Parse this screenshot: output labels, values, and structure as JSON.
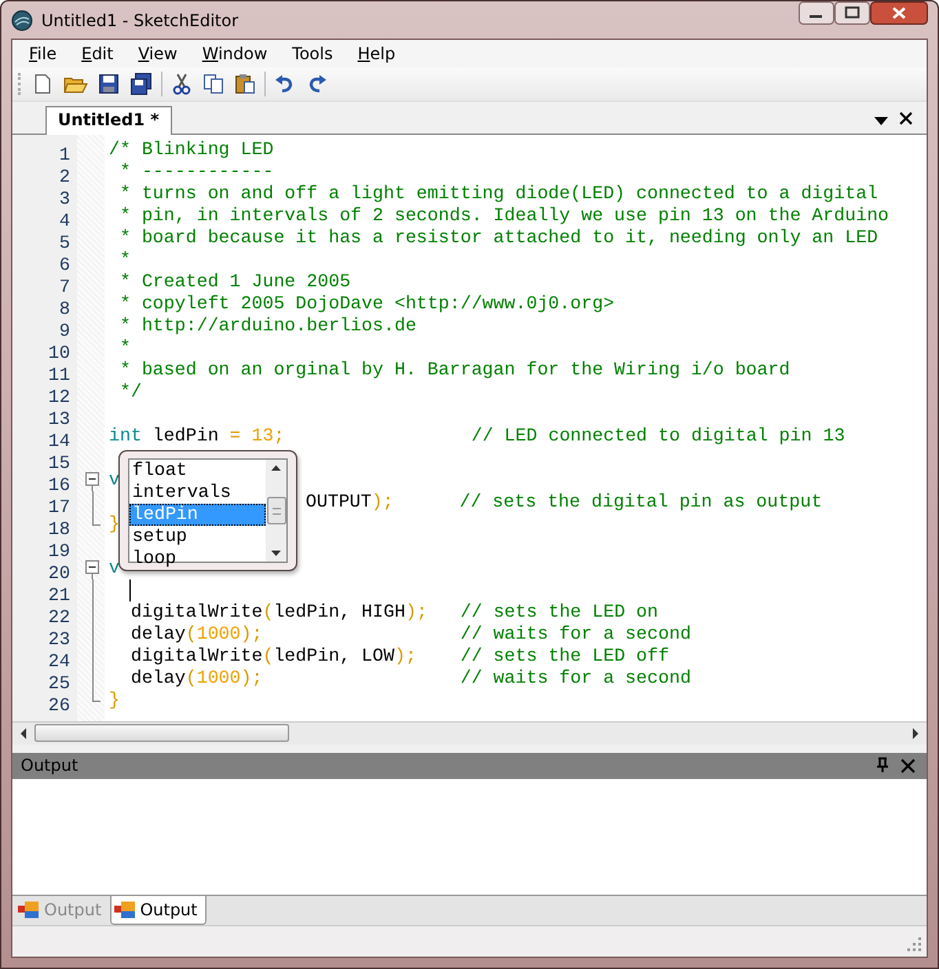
{
  "window": {
    "title": "Untitled1 - SketchEditor"
  },
  "menu": [
    {
      "label": "File",
      "underline": true
    },
    {
      "label": "Edit",
      "underline": true
    },
    {
      "label": "View",
      "underline": true
    },
    {
      "label": "Window",
      "underline": true
    },
    {
      "label": "Tools",
      "underline": false
    },
    {
      "label": "Help",
      "underline": true
    }
  ],
  "document_tabs": [
    {
      "label": "Untitled1 *",
      "selected": true
    }
  ],
  "editor": {
    "lines": [
      {
        "number": "1",
        "tokens": [
          {
            "kind": "comment",
            "text": "/* Blinking LED"
          }
        ]
      },
      {
        "number": "2",
        "tokens": [
          {
            "kind": "comment",
            "text": " * ------------"
          }
        ]
      },
      {
        "number": "3",
        "tokens": [
          {
            "kind": "comment",
            "text": " * turns on and off a light emitting diode(LED) connected to a digital"
          }
        ]
      },
      {
        "number": "4",
        "tokens": [
          {
            "kind": "comment",
            "text": " * pin, in intervals of 2 seconds. Ideally we use pin 13 on the Arduino"
          }
        ]
      },
      {
        "number": "5",
        "tokens": [
          {
            "kind": "comment",
            "text": " * board because it has a resistor attached to it, needing only an LED"
          }
        ]
      },
      {
        "number": "6",
        "tokens": [
          {
            "kind": "comment",
            "text": " *"
          }
        ]
      },
      {
        "number": "7",
        "tokens": [
          {
            "kind": "comment",
            "text": " * Created 1 June 2005"
          }
        ]
      },
      {
        "number": "8",
        "tokens": [
          {
            "kind": "comment",
            "text": " * copyleft 2005 DojoDave <http://www.0j0.org>"
          }
        ]
      },
      {
        "number": "9",
        "tokens": [
          {
            "kind": "comment",
            "text": " * http://arduino.berlios.de"
          }
        ]
      },
      {
        "number": "10",
        "tokens": [
          {
            "kind": "comment",
            "text": " *"
          }
        ]
      },
      {
        "number": "11",
        "tokens": [
          {
            "kind": "comment",
            "text": " * based on an orginal by H. Barragan for the Wiring i/o board"
          }
        ]
      },
      {
        "number": "12",
        "tokens": [
          {
            "kind": "comment",
            "text": " */"
          }
        ]
      },
      {
        "number": "13"
      },
      {
        "number": "14",
        "tokens": [
          {
            "kind": "keyword",
            "text": "int"
          },
          {
            "kind": "plain",
            "text": " ledPin "
          },
          {
            "kind": "op",
            "text": "="
          },
          {
            "kind": "number",
            "text": " 13"
          },
          {
            "kind": "op",
            "text": ";"
          },
          {
            "kind": "comment",
            "text": "                 // LED connected to digital pin 13"
          }
        ]
      },
      {
        "number": "15"
      },
      {
        "number": "16",
        "fold_open": true,
        "tokens": [
          {
            "kind": "keyword",
            "text": "v"
          }
        ]
      },
      {
        "number": "17",
        "in_fold": true,
        "hidden_start": true,
        "tokens": [
          {
            "kind": "plain",
            "text": "OUTPUT"
          },
          {
            "kind": "op",
            "text": ");"
          },
          {
            "kind": "comment",
            "text": "      // sets the digital pin as output"
          }
        ]
      },
      {
        "number": "18",
        "fold_end": true,
        "tokens": [
          {
            "kind": "op",
            "text": "}"
          }
        ]
      },
      {
        "number": "19"
      },
      {
        "number": "20",
        "fold_open": true,
        "tokens": [
          {
            "kind": "keyword",
            "text": "v"
          }
        ]
      },
      {
        "number": "21",
        "in_fold": true,
        "cursor": true
      },
      {
        "number": "22",
        "in_fold": true,
        "tokens": [
          {
            "kind": "plain",
            "text": "  digitalWrite"
          },
          {
            "kind": "op",
            "text": "("
          },
          {
            "kind": "plain",
            "text": "ledPin, HIGH"
          },
          {
            "kind": "op",
            "text": ");"
          },
          {
            "kind": "comment",
            "text": "   // sets the LED on"
          }
        ]
      },
      {
        "number": "23",
        "in_fold": true,
        "tokens": [
          {
            "kind": "plain",
            "text": "  delay"
          },
          {
            "kind": "op",
            "text": "("
          },
          {
            "kind": "number",
            "text": "1000"
          },
          {
            "kind": "op",
            "text": ");"
          },
          {
            "kind": "comment",
            "text": "                  // waits for a second"
          }
        ]
      },
      {
        "number": "24",
        "in_fold": true,
        "tokens": [
          {
            "kind": "plain",
            "text": "  digitalWrite"
          },
          {
            "kind": "op",
            "text": "("
          },
          {
            "kind": "plain",
            "text": "ledPin, LOW"
          },
          {
            "kind": "op",
            "text": ");"
          },
          {
            "kind": "comment",
            "text": "    // sets the LED off"
          }
        ]
      },
      {
        "number": "25",
        "in_fold": true,
        "tokens": [
          {
            "kind": "plain",
            "text": "  delay"
          },
          {
            "kind": "op",
            "text": "("
          },
          {
            "kind": "number",
            "text": "1000"
          },
          {
            "kind": "op",
            "text": ");"
          },
          {
            "kind": "comment",
            "text": "                  // waits for a second"
          }
        ]
      },
      {
        "number": "26",
        "fold_end": true,
        "tokens": [
          {
            "kind": "op",
            "text": "}"
          }
        ]
      }
    ],
    "autocomplete": [
      {
        "label": "float",
        "selected": false
      },
      {
        "label": "intervals",
        "selected": false
      },
      {
        "label": "ledPin",
        "selected": true
      },
      {
        "label": "setup",
        "selected": false
      },
      {
        "label": "loop",
        "selected": false
      }
    ]
  },
  "output_panel": {
    "title": "Output",
    "tabs": [
      {
        "label": "Output",
        "selected": false
      },
      {
        "label": "Output",
        "selected": true
      }
    ]
  }
}
